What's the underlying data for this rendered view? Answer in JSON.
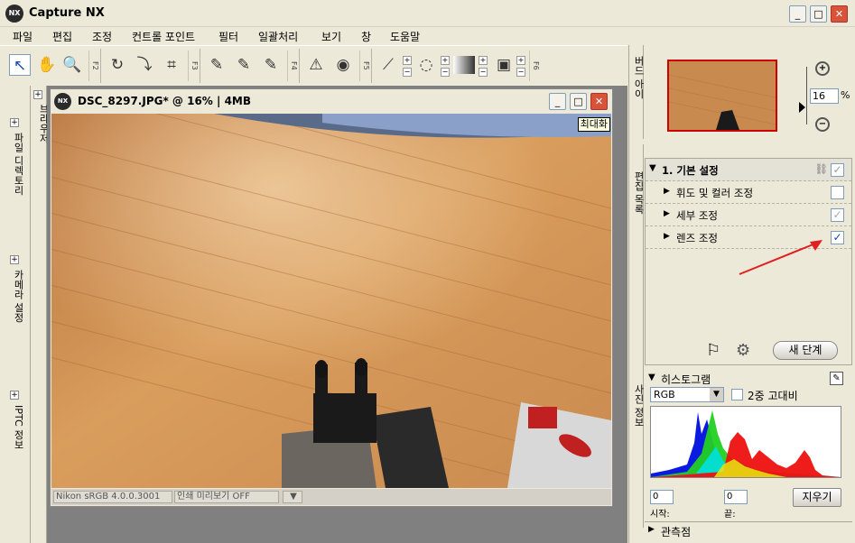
{
  "app": {
    "logo": "NX",
    "title": "Capture NX"
  },
  "window_controls": {
    "minimize": "_",
    "maximize": "□",
    "close": "✕"
  },
  "menu": [
    "파일",
    "편집",
    "조정",
    "컨트롤 포인트",
    "필터",
    "일괄처리",
    "보기",
    "창",
    "도움말"
  ],
  "toolbar": {
    "fkeys": [
      "F2",
      "F3",
      "F4",
      "F5",
      "F6"
    ]
  },
  "left_panels": {
    "browser": "브라우저",
    "folders": "파일 디렉토리",
    "camera": "카메라 설정",
    "iptc": "IPTC 정보"
  },
  "document": {
    "title": "DSC_8297.JPG* @ 16% | 4MB",
    "maximize_tooltip": "최대화",
    "status_profile": "Nikon sRGB 4.0.0.3001",
    "status_preview": "인쇄 미리보기 OFF",
    "status_dropdown": "▼"
  },
  "right_panels": {
    "bird_eye": "버드 아이",
    "edit_list": "편집 목록",
    "photo_info": "사진 정보",
    "zoom_value": "16",
    "zoom_unit": "%",
    "zoom_in": "+",
    "zoom_out": "−"
  },
  "edit_list": {
    "section_title": "1. 기본 설정",
    "items": [
      {
        "label": "휘도 및 컬러 조정",
        "checked": ""
      },
      {
        "label": "세부 조정",
        "checked": "✓"
      },
      {
        "label": "렌즈 조정",
        "checked": "✓"
      }
    ],
    "new_step_button": "새 단계"
  },
  "histogram": {
    "title": "히스토그램",
    "channel": "RGB",
    "double_contrast": "2중 고대비",
    "start_value": "0",
    "end_value": "0",
    "start_label": "시작:",
    "end_label": "끝:",
    "clear_button": "지우기"
  },
  "watch_point": {
    "label": "관측점"
  }
}
